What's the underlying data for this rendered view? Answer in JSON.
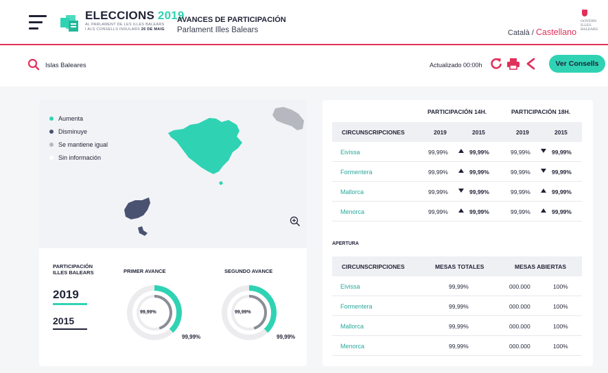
{
  "header": {
    "menu_icon": "hamburger-menu-icon",
    "logo_title": "ELECCIONS",
    "logo_year": "2019",
    "logo_sub1": "AL PARLAMENT DE LES ILLES BALEARS",
    "logo_sub2": "I ALS CONSELLS INSULARS",
    "logo_date": "26 DE MAIG",
    "title": "AVANCES DE PARTICIPACIÓN",
    "subtitle": "Parlament Illes Balears",
    "lang_catala": "Català",
    "lang_sep": "/",
    "lang_castellano": "Castellano",
    "govern_line1": "GOVERN",
    "govern_line2": "ILLES",
    "govern_line3": "BALEARS"
  },
  "toolbar": {
    "search_text": "Islas Baleares",
    "updated": "Actualizado 00:00h",
    "ver_consells": "Ver Consells",
    "icons": [
      "search-icon",
      "refresh-icon",
      "print-icon",
      "share-icon"
    ]
  },
  "legend": [
    {
      "label": "Aumenta",
      "color": "#2fd3b3"
    },
    {
      "label": "Disminuye",
      "color": "#4a5272"
    },
    {
      "label": "Se mantiene igual",
      "color": "#b5b8bf"
    },
    {
      "label": "Sin información",
      "color": "#ffffff"
    }
  ],
  "map_colors": {
    "mallorca": "#2fd3b3",
    "menorca": "#b5b8bf",
    "ibiza": "#4a5272",
    "formentera": "#4a5272"
  },
  "participacion": {
    "label_line1": "PARTICIPACIÓN",
    "label_line2": "ILLES BALEARS",
    "year_active": "2019",
    "year_other": "2015",
    "avance1": {
      "label": "PRIMER AVANCE",
      "inner": "99,99%",
      "outer": "99,99%",
      "outer_fraction": 0.38,
      "inner_fraction": 0.45
    },
    "avance2": {
      "label": "SEGUNDO AVANCE",
      "inner": "99,99%",
      "outer": "99,99%",
      "outer_fraction": 0.38,
      "inner_fraction": 0.45
    }
  },
  "table1": {
    "group_14": "PARTICIPACIÓN 14H.",
    "group_18": "PARTICIPACIÓN 18H.",
    "col_circ": "CIRCUNSCRIPCIONES",
    "col_2019": "2019",
    "col_2015": "2015",
    "rows": [
      {
        "name": "Eivissa",
        "a19": "99,99%",
        "a15": "99,99%",
        "dir14": "up",
        "b19": "99,99%",
        "b15": "99,99%",
        "dir18": "down"
      },
      {
        "name": "Formentera",
        "a19": "99,99%",
        "a15": "99,99%",
        "dir14": "up",
        "b19": "99,99%",
        "b15": "99,99%",
        "dir18": "down"
      },
      {
        "name": "Mallorca",
        "a19": "99,99%",
        "a15": "99,99%",
        "dir14": "down",
        "b19": "99,99%",
        "b15": "99,99%",
        "dir18": "up"
      },
      {
        "name": "Menorca",
        "a19": "99,99%",
        "a15": "99,99%",
        "dir14": "up",
        "b19": "99,99%",
        "b15": "99,99%",
        "dir18": "up"
      }
    ]
  },
  "table2": {
    "section": "APERTURA",
    "col_circ": "CIRCUNSCRIPCIONES",
    "col_totales": "MESAS TOTALES",
    "col_abiertas": "MESAS ABIERTAS",
    "rows": [
      {
        "name": "Eivissa",
        "totales": "99,99%",
        "abiertas": "000.000",
        "pct": "100%"
      },
      {
        "name": "Formentera",
        "totales": "99,99%",
        "abiertas": "000.000",
        "pct": "100%"
      },
      {
        "name": "Mallorca",
        "totales": "99,99%",
        "abiertas": "000.000",
        "pct": "100%"
      },
      {
        "name": "Menorca",
        "totales": "99,99%",
        "abiertas": "000.000",
        "pct": "100%"
      }
    ]
  }
}
